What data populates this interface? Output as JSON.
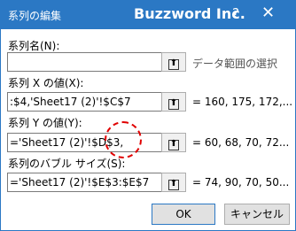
{
  "window": {
    "title": "系列の編集",
    "app_title": "Buzzword Inc.",
    "help": "?",
    "close": "✕"
  },
  "fields": [
    {
      "label": "系列名(N):",
      "value": "",
      "result": "データ範囲の選択"
    },
    {
      "label": "系列 X の値(X):",
      "value": ":$4,'Sheet17 (2)'!$C$7",
      "result": "= 160, 175, 172,..."
    },
    {
      "label": "系列 Y の値(Y):",
      "value": "='Sheet17 (2)'!$D$3,",
      "result": "= 60, 68, 70, 72..."
    },
    {
      "label": "系列のバブル サイズ(S):",
      "value": "='Sheet17 (2)'!$E$3:$E$7",
      "result": "= 74, 90, 70, 50..."
    }
  ],
  "buttons": {
    "ok": "OK",
    "cancel": "キャンセル"
  },
  "colors": {
    "title_bar": "#2b78c4",
    "annotation": "#e00000"
  },
  "icons": {
    "collapse": "collapse-dialog-icon"
  }
}
